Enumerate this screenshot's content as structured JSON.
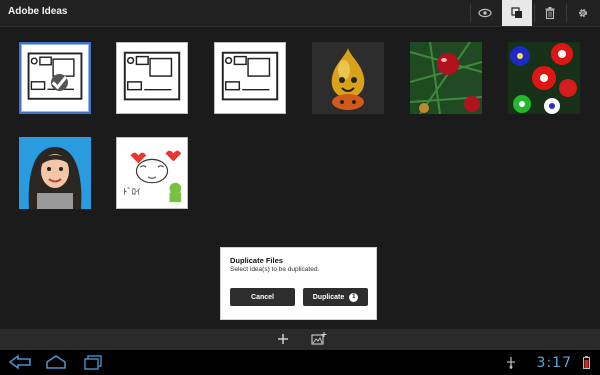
{
  "app": {
    "title": "Adobe Ideas"
  },
  "toolbar": {
    "buttons": [
      {
        "name": "view-icon",
        "active": false
      },
      {
        "name": "duplicate-icon",
        "active": true
      },
      {
        "name": "trash-icon",
        "active": false
      },
      {
        "name": "settings-icon",
        "active": false
      }
    ]
  },
  "thumbnails": [
    {
      "kind": "sketch",
      "selected": true
    },
    {
      "kind": "sketch",
      "selected": false
    },
    {
      "kind": "sketch",
      "selected": false
    },
    {
      "kind": "golden-slime-figure-photo",
      "selected": false
    },
    {
      "kind": "christmas-ornament-photo",
      "selected": false
    },
    {
      "kind": "flowers-photo",
      "selected": false
    },
    {
      "kind": "portrait-drawing",
      "selected": false
    },
    {
      "kind": "doodle-sketch",
      "selected": false
    }
  ],
  "dialog": {
    "title": "Duplicate Files",
    "message": "Select idea(s) to be duplicated.",
    "cancel_label": "Cancel",
    "duplicate_label": "Duplicate",
    "selected_count": "1"
  },
  "bottom_tools": {
    "icons": [
      "add-icon",
      "add-image-icon"
    ]
  },
  "system_bar": {
    "time": "3:17",
    "icons": [
      "back-icon",
      "home-icon",
      "recent-apps-icon",
      "usb-icon",
      "battery-icon"
    ]
  }
}
